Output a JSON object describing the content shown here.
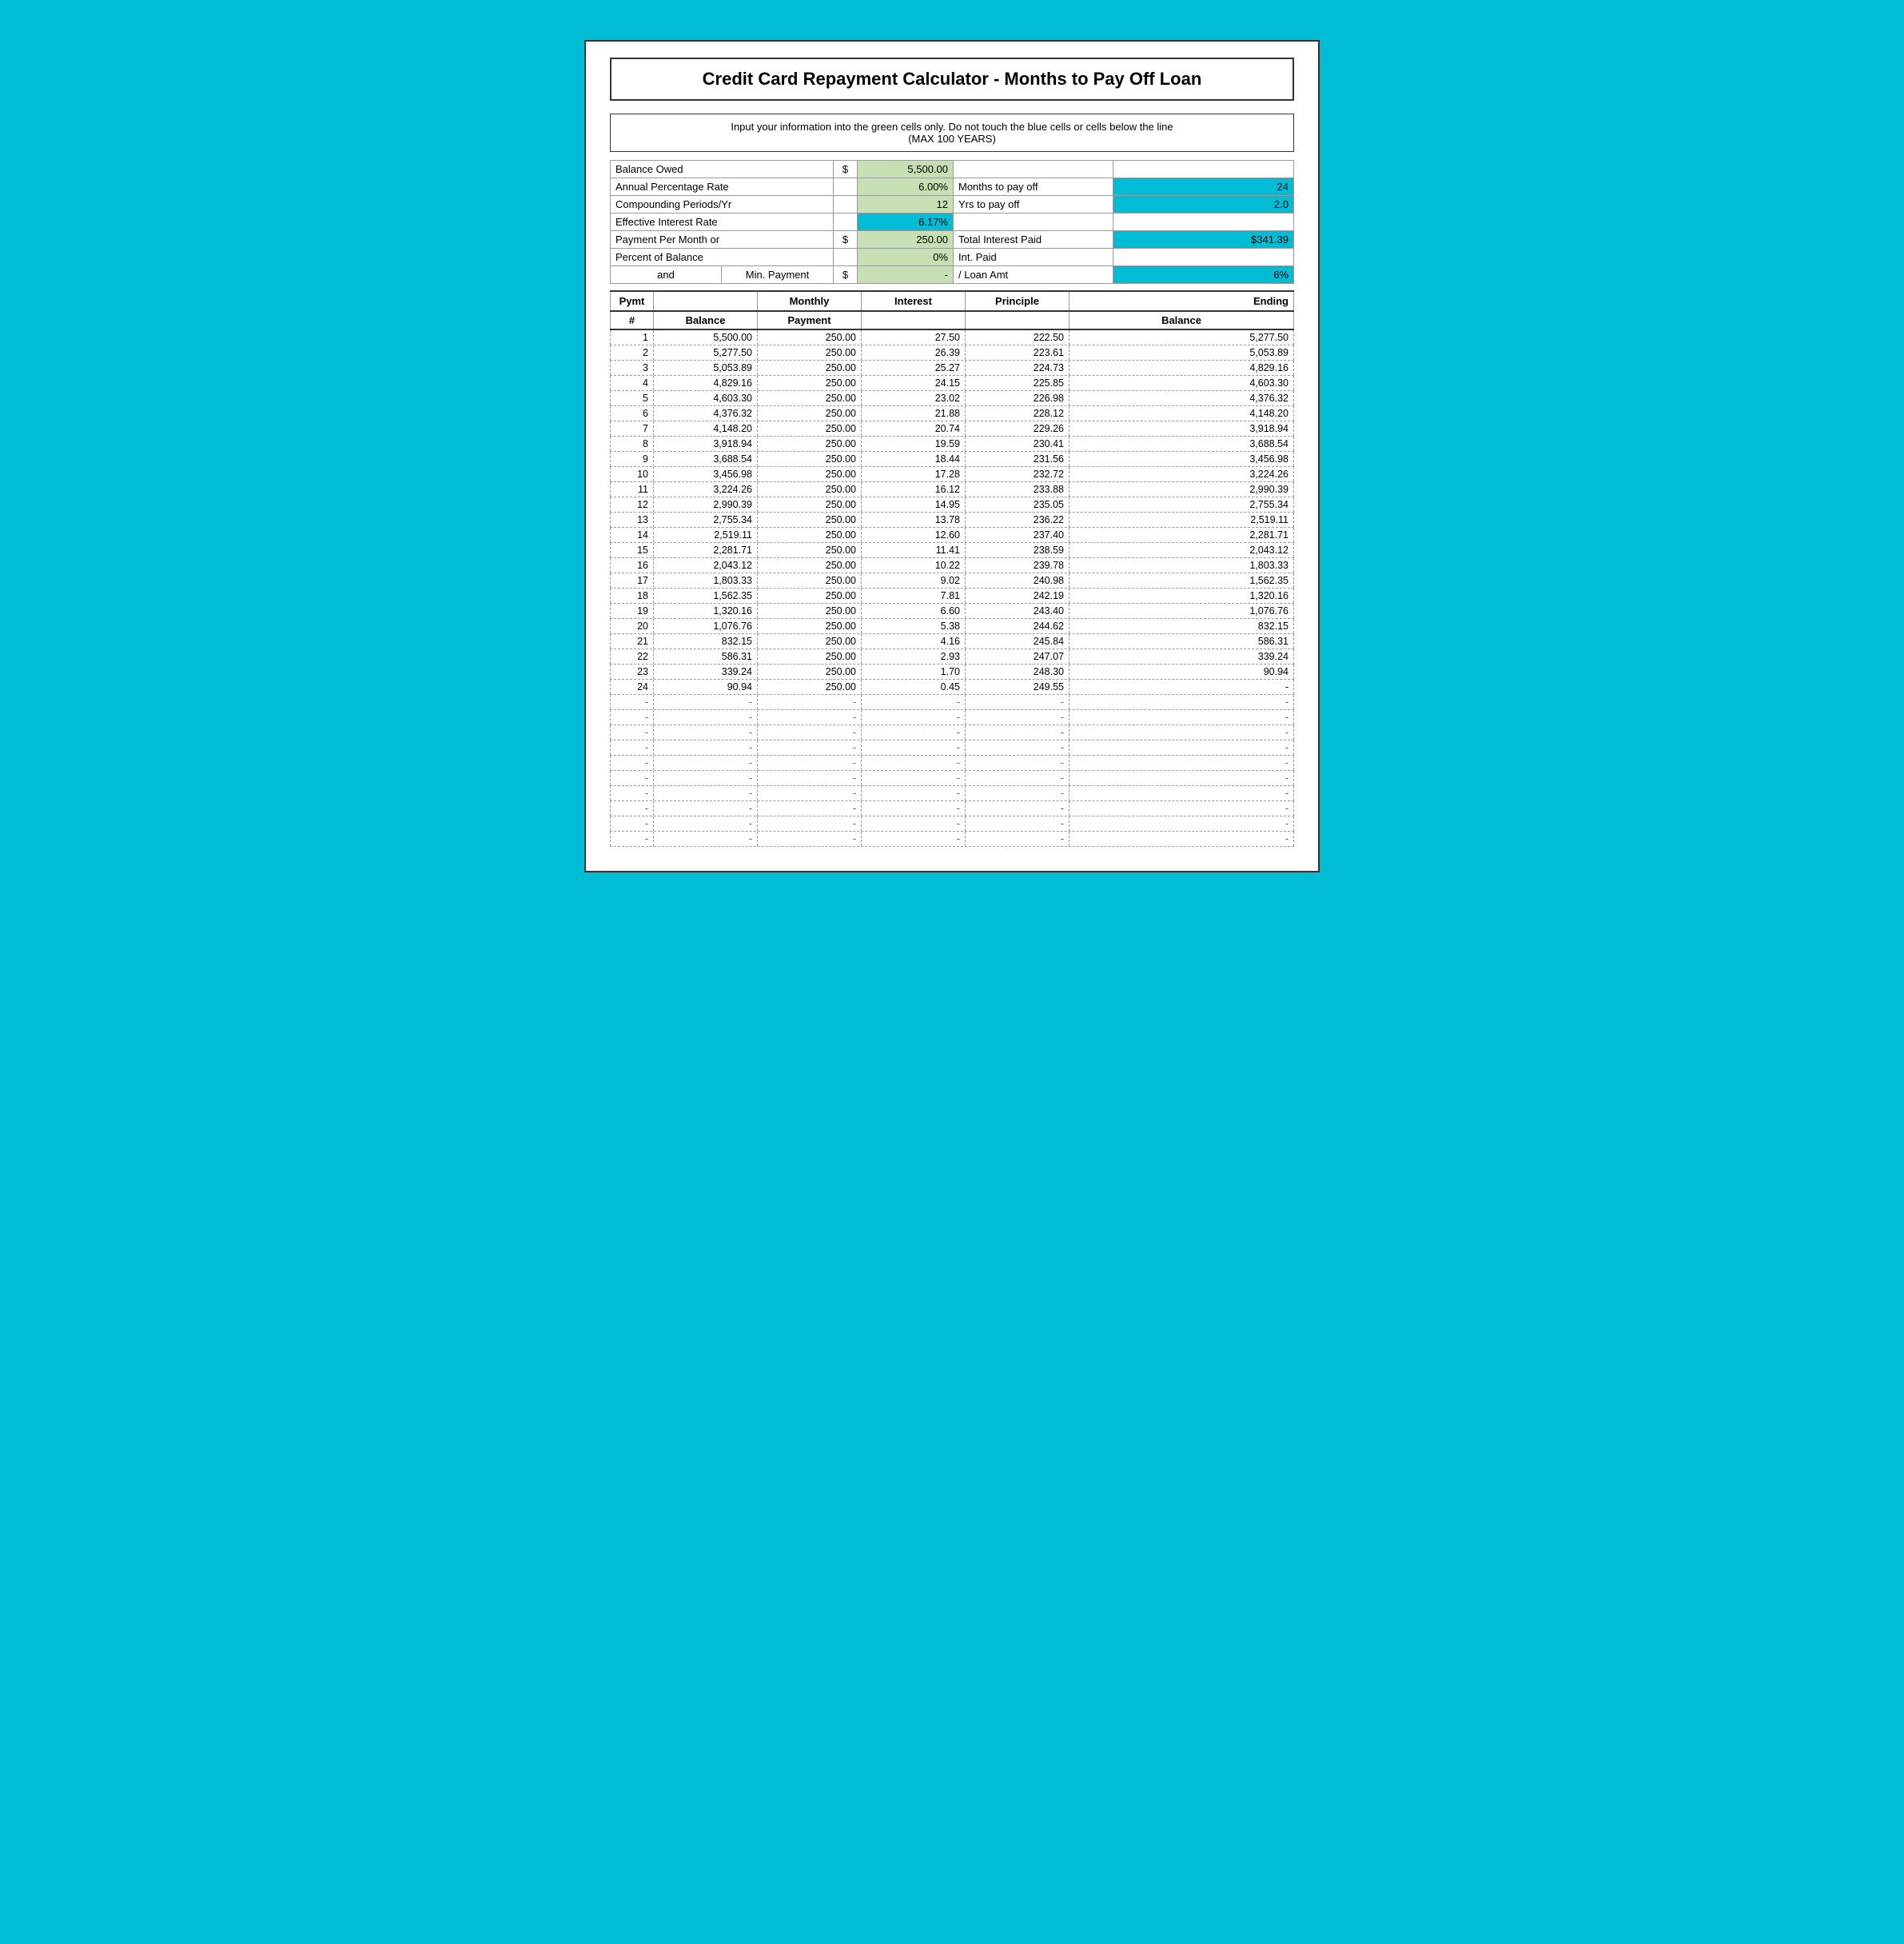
{
  "title": "Credit Card Repayment Calculator - Months to Pay Off Loan",
  "instructions": {
    "line1": "Input your information into the green cells only.  Do not touch the blue cells or cells below the line",
    "line2": "(MAX 100 YEARS)"
  },
  "inputs": {
    "balance_owed": {
      "label": "Balance Owed",
      "dollar": "$",
      "value": "5,500.00"
    },
    "apr": {
      "label": "Annual Percentage Rate",
      "value": "6.00%",
      "right_label": "Months to pay off",
      "right_value": "24"
    },
    "compounding": {
      "label": "Compounding Periods/Yr",
      "value": "12",
      "right_label": "Yrs to pay off",
      "right_value": "2.0"
    },
    "effective": {
      "label": "Effective Interest Rate",
      "value": "6.17%"
    },
    "payment_per_month": {
      "label": "Payment Per Month or",
      "dollar": "$",
      "value": "250.00",
      "right_label": "Total Interest Paid",
      "right_value": "$341.39"
    },
    "percent_of_balance": {
      "label": "Percent of Balance",
      "value": "0%",
      "right_label": "Int. Paid"
    },
    "and_row": {
      "and": "and",
      "min_payment": "Min. Payment",
      "dollar": "$",
      "value": "-",
      "right_label": "/ Loan Amt",
      "right_value": "6%"
    }
  },
  "table_headers": {
    "pymt": "Pymt",
    "balance": "Balance",
    "monthly": "Monthly",
    "interest": "Interest",
    "principle": "Principle",
    "ending": "Ending",
    "hash": "#",
    "payment": "Payment",
    "balance2": "Balance"
  },
  "rows": [
    {
      "num": "1",
      "balance": "5,500.00",
      "payment": "250.00",
      "interest": "27.50",
      "principle": "222.50",
      "ending": "5,277.50"
    },
    {
      "num": "2",
      "balance": "5,277.50",
      "payment": "250.00",
      "interest": "26.39",
      "principle": "223.61",
      "ending": "5,053.89"
    },
    {
      "num": "3",
      "balance": "5,053.89",
      "payment": "250.00",
      "interest": "25.27",
      "principle": "224.73",
      "ending": "4,829.16"
    },
    {
      "num": "4",
      "balance": "4,829.16",
      "payment": "250.00",
      "interest": "24.15",
      "principle": "225.85",
      "ending": "4,603.30"
    },
    {
      "num": "5",
      "balance": "4,603.30",
      "payment": "250.00",
      "interest": "23.02",
      "principle": "226.98",
      "ending": "4,376.32"
    },
    {
      "num": "6",
      "balance": "4,376.32",
      "payment": "250.00",
      "interest": "21.88",
      "principle": "228.12",
      "ending": "4,148.20"
    },
    {
      "num": "7",
      "balance": "4,148.20",
      "payment": "250.00",
      "interest": "20.74",
      "principle": "229.26",
      "ending": "3,918.94"
    },
    {
      "num": "8",
      "balance": "3,918.94",
      "payment": "250.00",
      "interest": "19.59",
      "principle": "230.41",
      "ending": "3,688.54"
    },
    {
      "num": "9",
      "balance": "3,688.54",
      "payment": "250.00",
      "interest": "18.44",
      "principle": "231.56",
      "ending": "3,456.98"
    },
    {
      "num": "10",
      "balance": "3,456.98",
      "payment": "250.00",
      "interest": "17.28",
      "principle": "232.72",
      "ending": "3,224.26"
    },
    {
      "num": "11",
      "balance": "3,224.26",
      "payment": "250.00",
      "interest": "16.12",
      "principle": "233.88",
      "ending": "2,990.39"
    },
    {
      "num": "12",
      "balance": "2,990.39",
      "payment": "250.00",
      "interest": "14.95",
      "principle": "235.05",
      "ending": "2,755.34"
    },
    {
      "num": "13",
      "balance": "2,755.34",
      "payment": "250.00",
      "interest": "13.78",
      "principle": "236.22",
      "ending": "2,519.11"
    },
    {
      "num": "14",
      "balance": "2,519.11",
      "payment": "250.00",
      "interest": "12.60",
      "principle": "237.40",
      "ending": "2,281.71"
    },
    {
      "num": "15",
      "balance": "2,281.71",
      "payment": "250.00",
      "interest": "11.41",
      "principle": "238.59",
      "ending": "2,043.12"
    },
    {
      "num": "16",
      "balance": "2,043.12",
      "payment": "250.00",
      "interest": "10.22",
      "principle": "239.78",
      "ending": "1,803.33"
    },
    {
      "num": "17",
      "balance": "1,803.33",
      "payment": "250.00",
      "interest": "9.02",
      "principle": "240.98",
      "ending": "1,562.35"
    },
    {
      "num": "18",
      "balance": "1,562.35",
      "payment": "250.00",
      "interest": "7.81",
      "principle": "242.19",
      "ending": "1,320.16"
    },
    {
      "num": "19",
      "balance": "1,320.16",
      "payment": "250.00",
      "interest": "6.60",
      "principle": "243.40",
      "ending": "1,076.76"
    },
    {
      "num": "20",
      "balance": "1,076.76",
      "payment": "250.00",
      "interest": "5.38",
      "principle": "244.62",
      "ending": "832.15"
    },
    {
      "num": "21",
      "balance": "832.15",
      "payment": "250.00",
      "interest": "4.16",
      "principle": "245.84",
      "ending": "586.31"
    },
    {
      "num": "22",
      "balance": "586.31",
      "payment": "250.00",
      "interest": "2.93",
      "principle": "247.07",
      "ending": "339.24"
    },
    {
      "num": "23",
      "balance": "339.24",
      "payment": "250.00",
      "interest": "1.70",
      "principle": "248.30",
      "ending": "90.94"
    },
    {
      "num": "24",
      "balance": "90.94",
      "payment": "250.00",
      "interest": "0.45",
      "principle": "249.55",
      "ending": "-"
    }
  ],
  "empty_rows": [
    "-",
    "-",
    "-",
    "-",
    "-",
    "-",
    "-",
    "-",
    "-",
    "-"
  ]
}
